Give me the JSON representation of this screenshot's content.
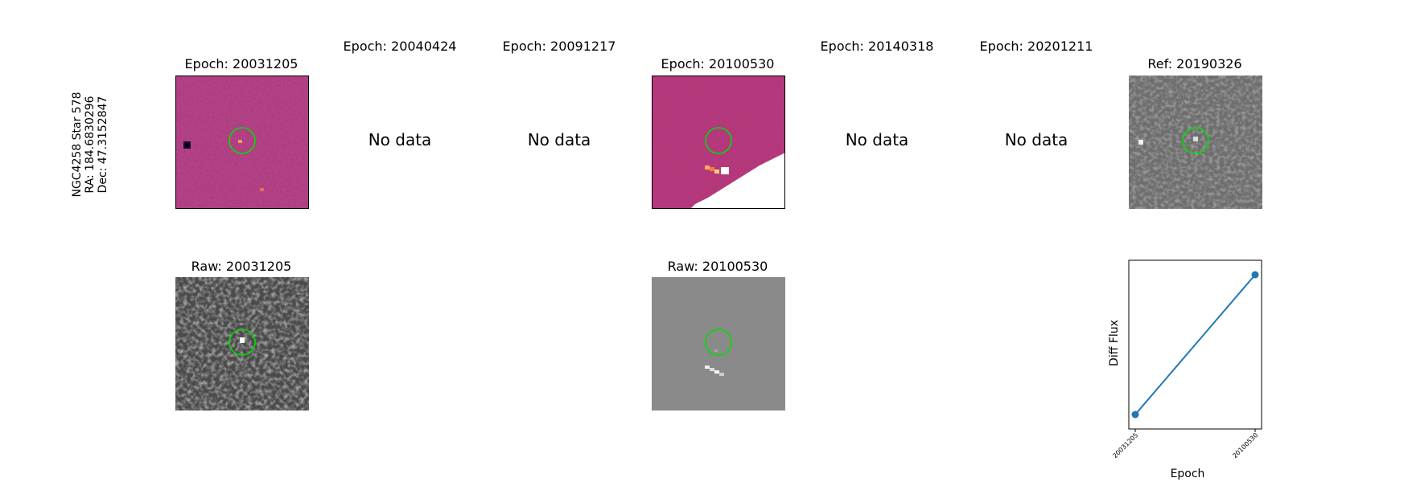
{
  "star_label": {
    "line1": "NGC4258 Star 578",
    "line2": "RA: 184.6830296",
    "line3": "Dec: 47.3152847"
  },
  "epochs": [
    {
      "title": "Epoch: 20031205",
      "status": "data"
    },
    {
      "title": "Epoch: 20040424",
      "status": "No data"
    },
    {
      "title": "Epoch: 20091217",
      "status": "No data"
    },
    {
      "title": "Epoch: 20100530",
      "status": "data"
    },
    {
      "title": "Epoch: 20140318",
      "status": "No data"
    },
    {
      "title": "Epoch: 20201211",
      "status": "No data"
    }
  ],
  "reference": {
    "title": "Ref: 20190326"
  },
  "raw": [
    {
      "title": "Raw: 20031205"
    },
    {
      "title": "Raw: 20100530"
    }
  ],
  "colors": {
    "circle": "#00dd00",
    "diff_bg": "#b5367a",
    "line": "#1f77b4"
  },
  "chart_data": {
    "type": "line",
    "xlabel": "Epoch",
    "ylabel": "Diff Flux",
    "categories": [
      "20031205",
      "20100530"
    ],
    "values": [
      0.0,
      1.0
    ],
    "grid": false,
    "marker": "circle"
  }
}
